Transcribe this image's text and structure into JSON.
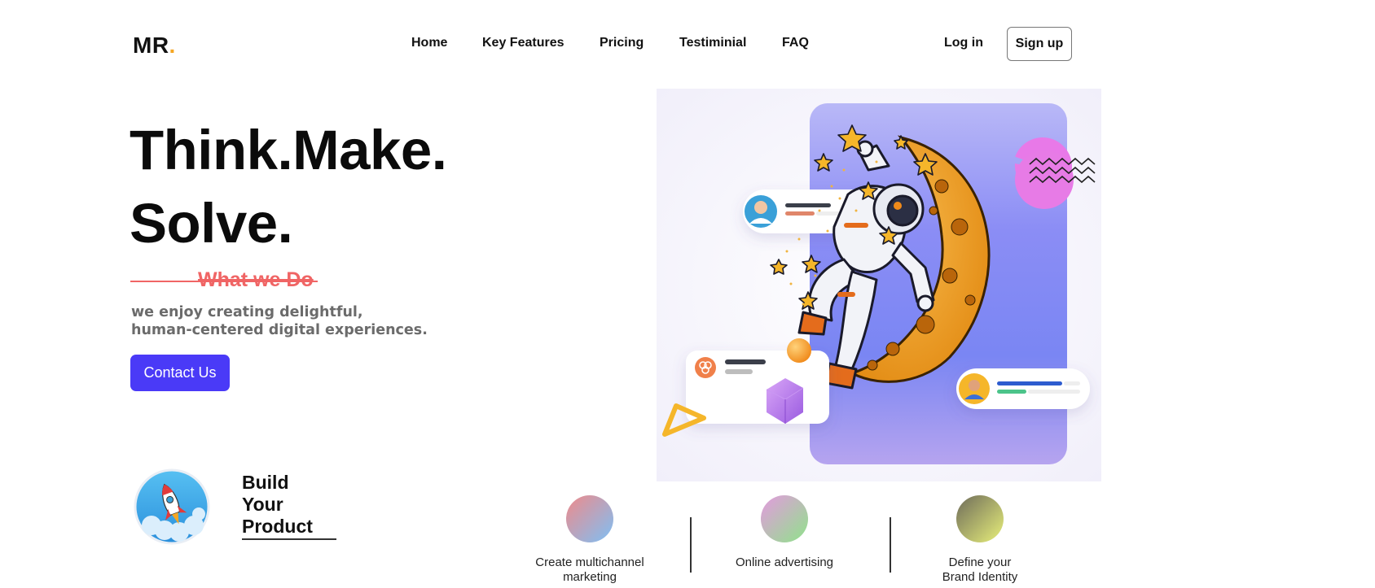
{
  "logo": {
    "text": "MR",
    "dot": "."
  },
  "nav": {
    "items": [
      {
        "label": "Home"
      },
      {
        "label": "Key Features"
      },
      {
        "label": "Pricing"
      },
      {
        "label": "Testiminial"
      },
      {
        "label": "FAQ"
      }
    ],
    "login_label": "Log in",
    "signup_label": "Sign up"
  },
  "hero": {
    "title_line1": "Think.Make.",
    "title_line2": "Solve.",
    "section_label": "What we Do",
    "description_line1": "we enjoy creating delightful,",
    "description_line2": "human-centered digital experiences.",
    "cta_label": "Contact Us"
  },
  "build": {
    "line1": "Build",
    "line2": "Your",
    "line3": "Product"
  },
  "features": [
    {
      "line1": "Create multichannel",
      "line2": "marketing",
      "icon": "gradient-circle",
      "colors": [
        "#ef8a8a",
        "#7ec0f5"
      ]
    },
    {
      "line1": "Online advertising",
      "line2": "",
      "icon": "gradient-circle",
      "colors": [
        "#e49adf",
        "#8fe38a"
      ]
    },
    {
      "line1": "Define your",
      "line2": "Brand Identity",
      "icon": "gradient-circle",
      "colors": [
        "#6e6b5a",
        "#e8f07a"
      ]
    }
  ],
  "colors": {
    "accent": "#4a3af7",
    "highlight": "#f06565",
    "logo_dot": "#f5a623"
  }
}
